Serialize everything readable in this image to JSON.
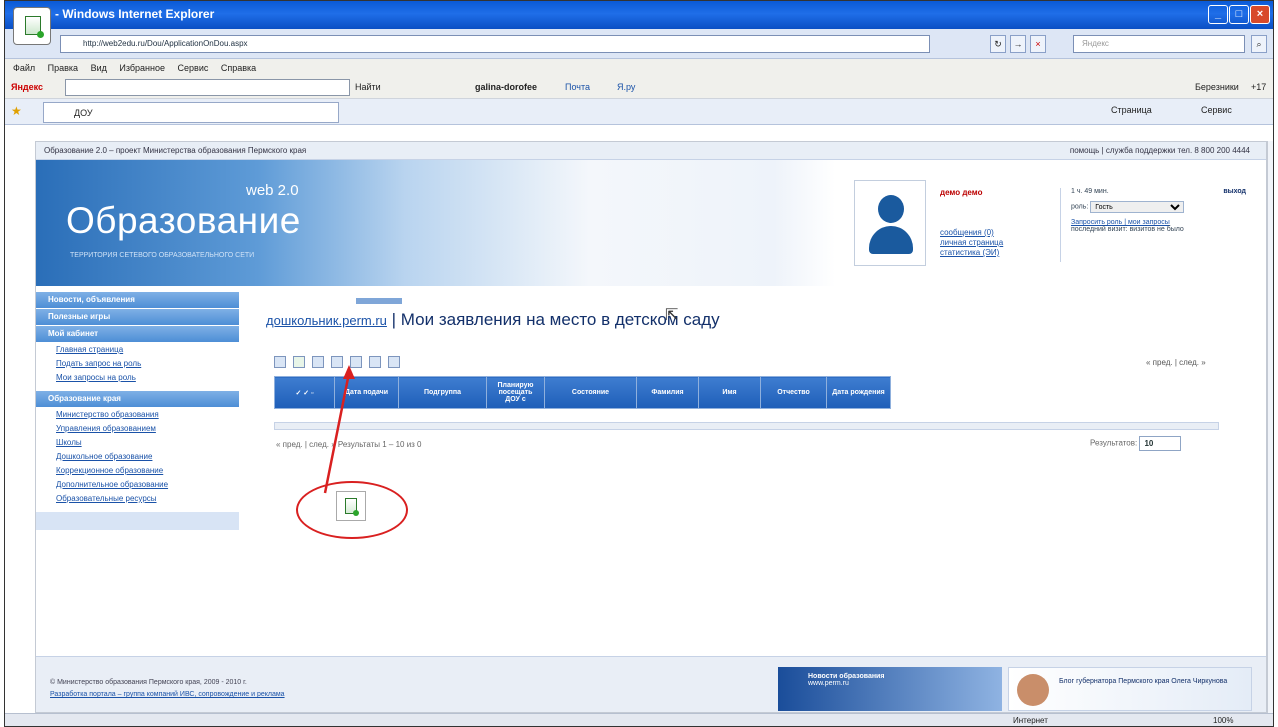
{
  "window": {
    "title": "- Windows Internet Explorer"
  },
  "address": {
    "url": "http://web2edu.ru/Dou/ApplicationOnDou.aspx",
    "search_placeholder": "Яндекс"
  },
  "menu": [
    "Файл",
    "Правка",
    "Вид",
    "Избранное",
    "Сервис",
    "Справка"
  ],
  "yandex_bar": {
    "label": "Яндекс",
    "find": "Найти",
    "user": "galina-dorofee",
    "mail": "Почта",
    "news": "Я.ру",
    "weather": "Березники",
    "temp": "+17"
  },
  "tab": {
    "title": "ДОУ"
  },
  "ie_toolbar": {
    "page": "Страница",
    "tools": "Сервис"
  },
  "site": {
    "top_strip": "Образование 2.0 – проект Министерства образования Пермского края",
    "top_links": "помощь | служба поддержки тел. 8 800 200 4444",
    "brand": "Образование",
    "web": "web 2.0",
    "slogan": "ТЕРРИТОРИЯ СЕТЕВОГО ОБРАЗОВАТЕЛЬНОГО СЕТИ",
    "user_name": "демо демо",
    "user_links": [
      "сообщения (0)",
      "личная страница",
      "статистика (ЭИ)"
    ],
    "time": "1 ч. 49 мин.",
    "logout": "выход",
    "role_label": "роль:",
    "role_value": "Гость",
    "role_links": "Запросить роль | мои запросы",
    "last_visit": "последний визит: визитов не было"
  },
  "sidebar": {
    "sections": [
      "Новости, объявления",
      "Полезные игры",
      "Мой кабинет"
    ],
    "cabinet_links": [
      "Главная страница",
      "Подать запрос на роль",
      "Мои запросы на роль"
    ],
    "region_section": "Образование края",
    "region_links": [
      "Министерство образования",
      "Управления образованием",
      "Школы",
      "Дошкольное образование",
      "Коррекционное образование",
      "Дополнительное образование",
      "Образовательные ресурсы"
    ]
  },
  "main": {
    "site_link": "дошкольник.perm.ru",
    "separator": " | ",
    "title": "Мои заявления на место в детском саду",
    "pager_top": "« пред. | след. »",
    "columns": [
      "Дата подачи",
      "Подгруппа",
      "Планирую посещать ДОУ с",
      "Состояние",
      "Фамилия",
      "Имя",
      "Отчество",
      "Дата рождения"
    ],
    "pager_bottom": "« пред. | след. »   Результаты 1 – 10 из 0",
    "results_label": "Результатов:",
    "results_value": "10"
  },
  "footer": {
    "copyright": "© Министерство образования Пермского края, 2009 - 2010 г.",
    "dev": "Разработка портала – группа компаний ИВС, сопровождение и реклама",
    "news_title": "Новости образования",
    "news_sub": "www.perm.ru",
    "blog": "Блог губернатора Пермского края Олега Чиркунова"
  },
  "status": {
    "zone": "Интернет",
    "zoom": "100%"
  }
}
